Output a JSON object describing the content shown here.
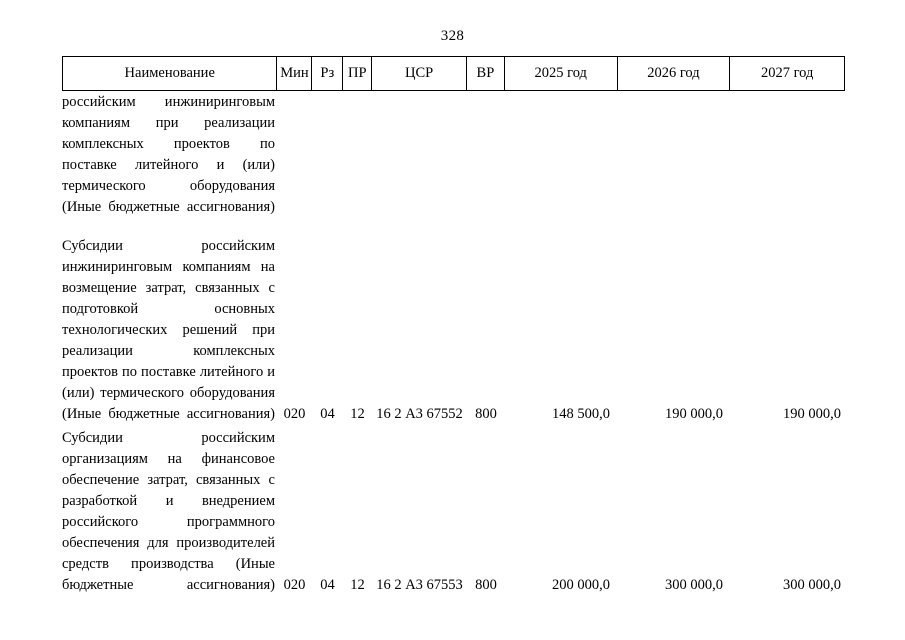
{
  "document": {
    "page_number": "328"
  },
  "table": {
    "columns": [
      {
        "key": "name",
        "label": "Наименование"
      },
      {
        "key": "min",
        "label": "Мин"
      },
      {
        "key": "rz",
        "label": "Рз"
      },
      {
        "key": "pr",
        "label": "ПР"
      },
      {
        "key": "csr",
        "label": "ЦСР"
      },
      {
        "key": "vr",
        "label": "ВР"
      },
      {
        "key": "y2025",
        "label": "2025 год"
      },
      {
        "key": "y2026",
        "label": "2026 год"
      },
      {
        "key": "y2027",
        "label": "2027 год"
      }
    ],
    "rows": [
      {
        "description": "российским инжиниринговым компаниям при реализации комплексных проектов по поставке литейного и (или) термического оборудования (Иные бюджетные ассигнования)",
        "min": "",
        "rz": "",
        "pr": "",
        "csr": "",
        "vr": "",
        "y2025": "",
        "y2026": "",
        "y2027": ""
      },
      {
        "description": "Субсидии российским инжиниринговым компаниям на возмещение затрат, связанных с подготовкой основных технологических решений при реализации комплексных проектов по поставке литейного и (или) термического оборудования (Иные бюджетные ассигнования)",
        "min": "020",
        "rz": "04",
        "pr": "12",
        "csr": "16 2 А3 67552",
        "vr": "800",
        "y2025": "148 500,0",
        "y2026": "190 000,0",
        "y2027": "190 000,0"
      },
      {
        "description": "Субсидии российским организациям на финансовое обеспечение затрат, связанных с разработкой и внедрением российского программного обеспечения для производителей средств производства (Иные бюджетные ассигнования)",
        "min": "020",
        "rz": "04",
        "pr": "12",
        "csr": "16 2 А3 67553",
        "vr": "800",
        "y2025": "200 000,0",
        "y2026": "300 000,0",
        "y2027": "300 000,0"
      }
    ]
  }
}
